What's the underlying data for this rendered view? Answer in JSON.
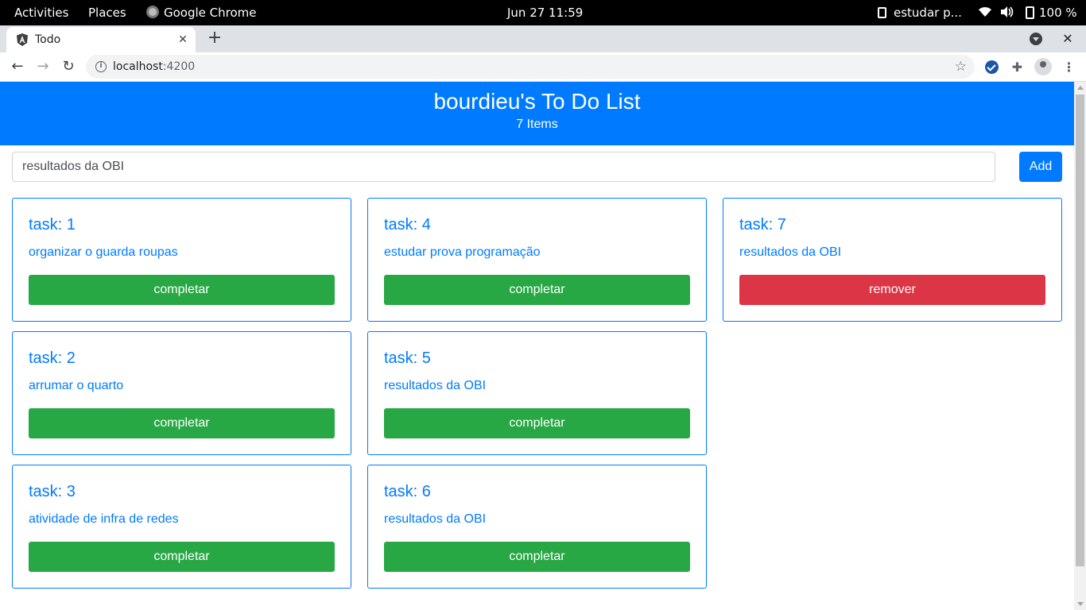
{
  "system_bar": {
    "activities": "Activities",
    "places": "Places",
    "app_name": "Google Chrome",
    "clock": "Jun 27  11:59",
    "task_label": "estudar p...",
    "battery": "100 %"
  },
  "browser": {
    "tab_title": "Todo",
    "url_host": "localhost",
    "url_port": ":4200"
  },
  "app": {
    "title": "bourdieu's To Do List",
    "item_count": "7 Items",
    "input_value": "resultados da OBI",
    "add_label": "Add",
    "tasks": [
      {
        "title": "task: 1",
        "text": "organizar o guarda roupas",
        "button": "completar"
      },
      {
        "title": "task: 2",
        "text": "arrumar o quarto",
        "button": "completar"
      },
      {
        "title": "task: 3",
        "text": "atividade de infra de redes",
        "button": "completar"
      },
      {
        "title": "task: 4",
        "text": "estudar prova programação",
        "button": "completar"
      },
      {
        "title": "task: 5",
        "text": "resultados da OBI",
        "button": "completar"
      },
      {
        "title": "task: 6",
        "text": "resultados da OBI",
        "button": "completar"
      },
      {
        "title": "task: 7",
        "text": "resultados da OBI",
        "button": "remover"
      }
    ]
  },
  "colors": {
    "primary": "#007bff",
    "success": "#28a745",
    "danger": "#dc3545"
  }
}
